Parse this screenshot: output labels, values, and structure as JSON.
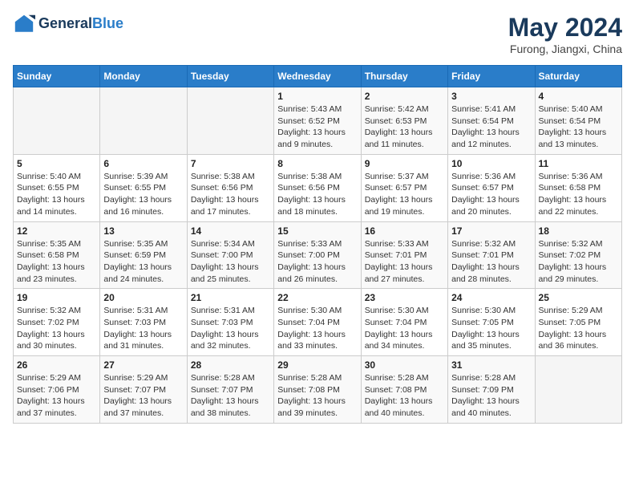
{
  "header": {
    "logo_general": "General",
    "logo_blue": "Blue",
    "main_title": "May 2024",
    "subtitle": "Furong, Jiangxi, China"
  },
  "days_of_week": [
    "Sunday",
    "Monday",
    "Tuesday",
    "Wednesday",
    "Thursday",
    "Friday",
    "Saturday"
  ],
  "weeks": [
    [
      {
        "num": "",
        "info": ""
      },
      {
        "num": "",
        "info": ""
      },
      {
        "num": "",
        "info": ""
      },
      {
        "num": "1",
        "info": "Sunrise: 5:43 AM\nSunset: 6:52 PM\nDaylight: 13 hours and 9 minutes."
      },
      {
        "num": "2",
        "info": "Sunrise: 5:42 AM\nSunset: 6:53 PM\nDaylight: 13 hours and 11 minutes."
      },
      {
        "num": "3",
        "info": "Sunrise: 5:41 AM\nSunset: 6:54 PM\nDaylight: 13 hours and 12 minutes."
      },
      {
        "num": "4",
        "info": "Sunrise: 5:40 AM\nSunset: 6:54 PM\nDaylight: 13 hours and 13 minutes."
      }
    ],
    [
      {
        "num": "5",
        "info": "Sunrise: 5:40 AM\nSunset: 6:55 PM\nDaylight: 13 hours and 14 minutes."
      },
      {
        "num": "6",
        "info": "Sunrise: 5:39 AM\nSunset: 6:55 PM\nDaylight: 13 hours and 16 minutes."
      },
      {
        "num": "7",
        "info": "Sunrise: 5:38 AM\nSunset: 6:56 PM\nDaylight: 13 hours and 17 minutes."
      },
      {
        "num": "8",
        "info": "Sunrise: 5:38 AM\nSunset: 6:56 PM\nDaylight: 13 hours and 18 minutes."
      },
      {
        "num": "9",
        "info": "Sunrise: 5:37 AM\nSunset: 6:57 PM\nDaylight: 13 hours and 19 minutes."
      },
      {
        "num": "10",
        "info": "Sunrise: 5:36 AM\nSunset: 6:57 PM\nDaylight: 13 hours and 20 minutes."
      },
      {
        "num": "11",
        "info": "Sunrise: 5:36 AM\nSunset: 6:58 PM\nDaylight: 13 hours and 22 minutes."
      }
    ],
    [
      {
        "num": "12",
        "info": "Sunrise: 5:35 AM\nSunset: 6:58 PM\nDaylight: 13 hours and 23 minutes."
      },
      {
        "num": "13",
        "info": "Sunrise: 5:35 AM\nSunset: 6:59 PM\nDaylight: 13 hours and 24 minutes."
      },
      {
        "num": "14",
        "info": "Sunrise: 5:34 AM\nSunset: 7:00 PM\nDaylight: 13 hours and 25 minutes."
      },
      {
        "num": "15",
        "info": "Sunrise: 5:33 AM\nSunset: 7:00 PM\nDaylight: 13 hours and 26 minutes."
      },
      {
        "num": "16",
        "info": "Sunrise: 5:33 AM\nSunset: 7:01 PM\nDaylight: 13 hours and 27 minutes."
      },
      {
        "num": "17",
        "info": "Sunrise: 5:32 AM\nSunset: 7:01 PM\nDaylight: 13 hours and 28 minutes."
      },
      {
        "num": "18",
        "info": "Sunrise: 5:32 AM\nSunset: 7:02 PM\nDaylight: 13 hours and 29 minutes."
      }
    ],
    [
      {
        "num": "19",
        "info": "Sunrise: 5:32 AM\nSunset: 7:02 PM\nDaylight: 13 hours and 30 minutes."
      },
      {
        "num": "20",
        "info": "Sunrise: 5:31 AM\nSunset: 7:03 PM\nDaylight: 13 hours and 31 minutes."
      },
      {
        "num": "21",
        "info": "Sunrise: 5:31 AM\nSunset: 7:03 PM\nDaylight: 13 hours and 32 minutes."
      },
      {
        "num": "22",
        "info": "Sunrise: 5:30 AM\nSunset: 7:04 PM\nDaylight: 13 hours and 33 minutes."
      },
      {
        "num": "23",
        "info": "Sunrise: 5:30 AM\nSunset: 7:04 PM\nDaylight: 13 hours and 34 minutes."
      },
      {
        "num": "24",
        "info": "Sunrise: 5:30 AM\nSunset: 7:05 PM\nDaylight: 13 hours and 35 minutes."
      },
      {
        "num": "25",
        "info": "Sunrise: 5:29 AM\nSunset: 7:05 PM\nDaylight: 13 hours and 36 minutes."
      }
    ],
    [
      {
        "num": "26",
        "info": "Sunrise: 5:29 AM\nSunset: 7:06 PM\nDaylight: 13 hours and 37 minutes."
      },
      {
        "num": "27",
        "info": "Sunrise: 5:29 AM\nSunset: 7:07 PM\nDaylight: 13 hours and 37 minutes."
      },
      {
        "num": "28",
        "info": "Sunrise: 5:28 AM\nSunset: 7:07 PM\nDaylight: 13 hours and 38 minutes."
      },
      {
        "num": "29",
        "info": "Sunrise: 5:28 AM\nSunset: 7:08 PM\nDaylight: 13 hours and 39 minutes."
      },
      {
        "num": "30",
        "info": "Sunrise: 5:28 AM\nSunset: 7:08 PM\nDaylight: 13 hours and 40 minutes."
      },
      {
        "num": "31",
        "info": "Sunrise: 5:28 AM\nSunset: 7:09 PM\nDaylight: 13 hours and 40 minutes."
      },
      {
        "num": "",
        "info": ""
      }
    ]
  ]
}
